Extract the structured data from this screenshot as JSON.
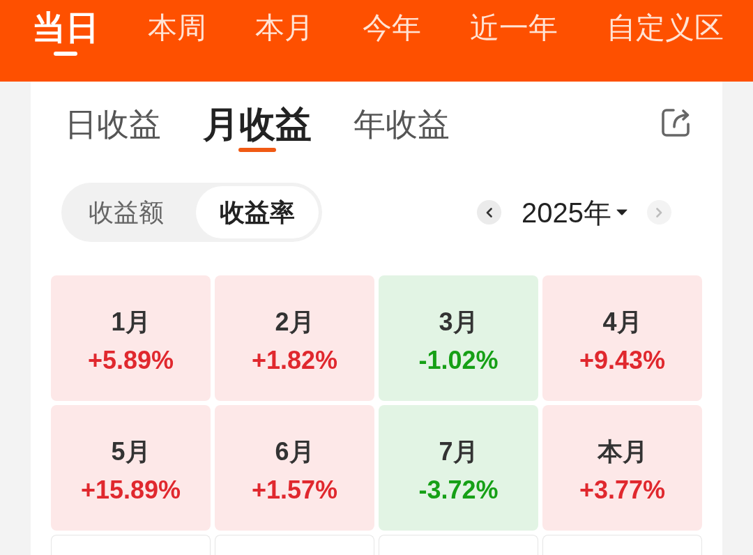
{
  "period_tabs": [
    {
      "label": "当日",
      "selected": true
    },
    {
      "label": "本周",
      "selected": false
    },
    {
      "label": "本月",
      "selected": false
    },
    {
      "label": "今年",
      "selected": false
    },
    {
      "label": "近一年",
      "selected": false
    },
    {
      "label": "自定义区",
      "selected": false
    }
  ],
  "profit_tabs": [
    {
      "label": "日收益",
      "selected": false
    },
    {
      "label": "月收益",
      "selected": true
    },
    {
      "label": "年收益",
      "selected": false
    }
  ],
  "metric_toggle": [
    {
      "label": "收益额",
      "selected": false
    },
    {
      "label": "收益率",
      "selected": true
    }
  ],
  "year_picker": {
    "value": "2025年",
    "prev": {
      "disabled": false
    },
    "next": {
      "disabled": true
    }
  },
  "month_cells": [
    {
      "kind": "gain",
      "label": "1月",
      "value": "+5.89%"
    },
    {
      "kind": "gain",
      "label": "2月",
      "value": "+1.82%"
    },
    {
      "kind": "loss",
      "label": "3月",
      "value": "-1.02%"
    },
    {
      "kind": "gain",
      "label": "4月",
      "value": "+9.43%"
    },
    {
      "kind": "gain",
      "label": "5月",
      "value": "+15.89%"
    },
    {
      "kind": "gain",
      "label": "6月",
      "value": "+1.57%"
    },
    {
      "kind": "loss",
      "label": "7月",
      "value": "-3.72%"
    },
    {
      "kind": "gain",
      "label": "本月",
      "value": "+3.77%"
    },
    {
      "kind": "empty"
    },
    {
      "kind": "empty"
    },
    {
      "kind": "empty"
    },
    {
      "kind": "empty"
    }
  ]
}
